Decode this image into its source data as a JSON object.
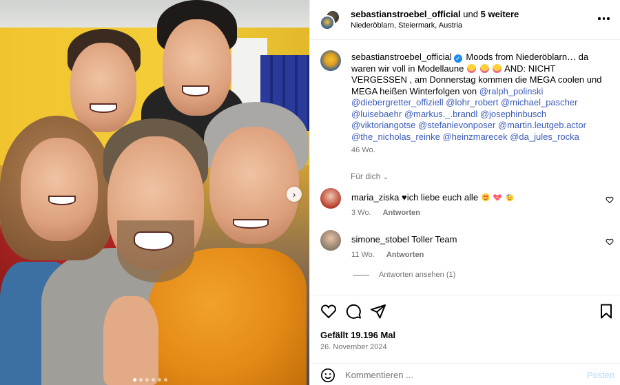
{
  "photo": {
    "alt": "Selfie of five people",
    "carousel_dots": 6,
    "active_dot": 0,
    "next_icon": "chevron-right-icon"
  },
  "header": {
    "username": "sebastianstroebel_official",
    "collab_joiner": "und",
    "collab_others": "5 weitere",
    "location": "Niederöblarn, Steiermark, Austria",
    "more_icon": "more-horizontal-icon"
  },
  "caption": {
    "username": "sebastianstroebel_official",
    "text_part1": "Moods from Niederöblarn… da waren wir voll in Modellaune",
    "text_part2": "AND: NICHT VERGESSEN , am Donnerstag kommen die MEGA coolen und MEGA heißen Winterfolgen von",
    "mentions": [
      "@ralph_polinski",
      "@diebergretter_offiziell",
      "@lohr_robert",
      "@michael_pascher",
      "@luisebaehr",
      "@markus._.brandl",
      "@josephinbusch",
      "@viktoriangotse",
      "@stefanievonposer",
      "@martin.leutgeb.actor",
      "@the_nicholas_reinke",
      "@heinzmarecek",
      "@da_jules_rocka"
    ],
    "time": "46 Wo."
  },
  "for_you": "Für dich",
  "comments": [
    {
      "user": "maria_ziska",
      "text": "ich liebe euch alle",
      "time": "3 Wo.",
      "reply": "Antworten"
    },
    {
      "user": "simone_stobel",
      "text": "Toller Team",
      "time": "11 Wo.",
      "reply": "Antworten"
    }
  ],
  "show_replies": "Antworten ansehen (1)",
  "actions": {
    "likes": "Gefällt 19.196 Mal",
    "date": "26. November 2024"
  },
  "comment_box": {
    "placeholder": "Kommentieren ...",
    "post_label": "Posten"
  },
  "colors": {
    "mention": "#3a5bb8",
    "secondary_text": "#737373",
    "post_disabled": "#b3d8f9",
    "verified": "#1a8cf0"
  }
}
